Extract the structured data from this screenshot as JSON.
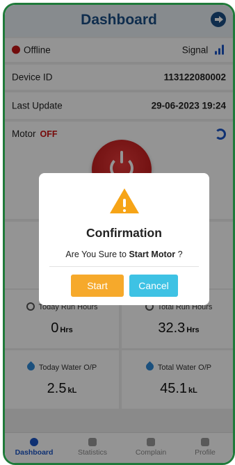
{
  "header": {
    "title": "Dashboard",
    "logout_icon": "logout-icon"
  },
  "status": {
    "state": "Offline",
    "state_color": "#c51616",
    "signal_label": "Signal"
  },
  "device": {
    "id_label": "Device ID",
    "id_value": "113122080002"
  },
  "update": {
    "label": "Last Update",
    "value": "29-06-2023 19:24"
  },
  "motor": {
    "label": "Motor",
    "status": "OFF",
    "status_color": "#cc1111"
  },
  "stats": {
    "today_run_hours": {
      "label": "Today Run Hours",
      "value": "0",
      "unit": "Hrs"
    },
    "total_run_hours": {
      "label": "Total Run Hours",
      "value": "32.3",
      "unit": "Hrs"
    },
    "today_water": {
      "label": "Today Water O/P",
      "value": "2.5",
      "unit": "kL"
    },
    "total_water": {
      "label": "Total Water O/P",
      "value": "45.1",
      "unit": "kL"
    }
  },
  "dialog": {
    "title": "Confirmation",
    "message_prefix": "Are You Sure to",
    "message_action": "Start Motor",
    "message_suffix": "?",
    "confirm_label": "Start",
    "cancel_label": "Cancel",
    "icon": "warning-icon"
  },
  "nav": {
    "items": [
      {
        "label": "Dashboard",
        "icon": "dashboard-icon"
      },
      {
        "label": "Statistics",
        "icon": "statistics-icon"
      },
      {
        "label": "Complain",
        "icon": "complain-icon"
      },
      {
        "label": "Profile",
        "icon": "profile-icon"
      }
    ]
  },
  "colors": {
    "brand": "#1b4f86",
    "accent": "#1b55c7",
    "frame": "#1f7a3a",
    "warning": "#f6a417",
    "start": "#f6a92b",
    "cancel": "#3ec2e4"
  }
}
